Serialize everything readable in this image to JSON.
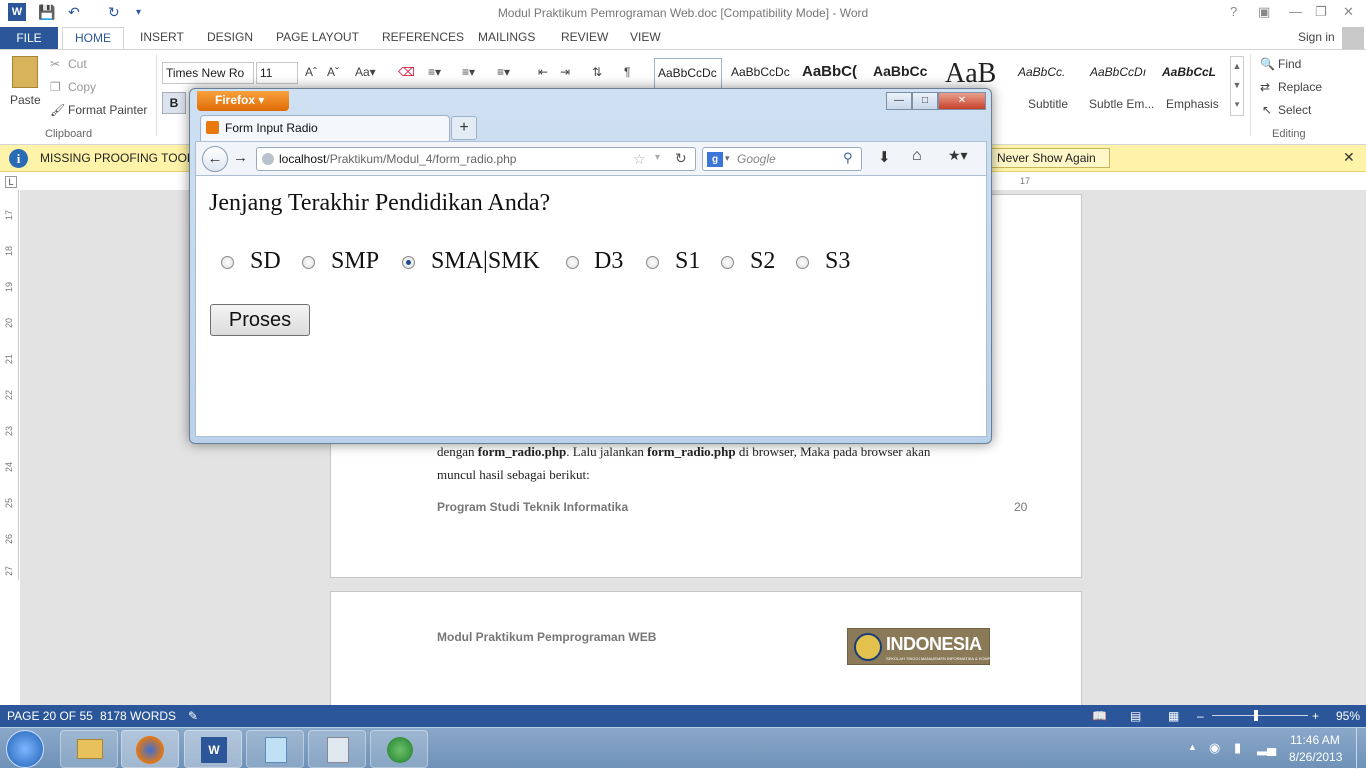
{
  "word": {
    "window_title": "Modul Praktikum Pemrograman Web.doc [Compatibility Mode] - Word",
    "tabs": [
      "FILE",
      "HOME",
      "INSERT",
      "DESIGN",
      "PAGE LAYOUT",
      "REFERENCES",
      "MAILINGS",
      "REVIEW",
      "VIEW"
    ],
    "sign_in": "Sign in",
    "help": "?",
    "clipboard": {
      "paste": "Paste",
      "cut": "Cut",
      "copy": "Copy",
      "format_painter": "Format Painter",
      "label": "Clipboard"
    },
    "font": {
      "name": "Times New Ro",
      "size": "11",
      "bold": "B"
    },
    "styles": [
      {
        "sample": "AaBbCcDc",
        "name": ""
      },
      {
        "sample": "AaBbCcDc",
        "name": ""
      },
      {
        "sample": "AaBbC(",
        "name": ""
      },
      {
        "sample": "AaBbCc",
        "name": ""
      },
      {
        "sample": "AaB",
        "name": ""
      },
      {
        "sample": "AaBbCc.",
        "name": "Subtitle"
      },
      {
        "sample": "AaBbCcDı",
        "name": "Subtle Em..."
      },
      {
        "sample": "AaBbCcL",
        "name": "Emphasis"
      }
    ],
    "editing": {
      "find": "Find",
      "replace": "Replace",
      "select": "Select",
      "label": "Editing"
    },
    "infobar": {
      "text": "MISSING PROOFING TOOLS",
      "button": "Never Show Again"
    },
    "ruler_top_marker": "17",
    "vruler_numbers": [
      "17",
      "18",
      "19",
      "20",
      "21",
      "22",
      "23",
      "24",
      "25",
      "26",
      "27"
    ],
    "page1": {
      "body_line1_a": "dengan ",
      "body_line1_b": "form_radio.php",
      "body_line1_c": ". Lalu jalankan ",
      "body_line1_d": "form_radio.php",
      "body_line1_e": " di browser, Maka pada browser akan",
      "body_line2": "muncul hasil sebagai berikut:",
      "footer_left": "Program Studi Teknik Informatika",
      "footer_right": "20"
    },
    "page2": {
      "header_left": "Modul Praktikum Pemprograman WEB",
      "logo_text": "INDONESIA",
      "logo_subtext": "SEKOLAH TINGGI MANAJEMEN INFORMATIKA & KOMPUTER"
    },
    "status": {
      "page": "PAGE 20 OF 55",
      "words": "8178 WORDS",
      "zoom": "95%"
    }
  },
  "firefox": {
    "menu_button": "Firefox",
    "tab_title": "Form Input Radio",
    "url_host": "localhost",
    "url_path": "/Praktikum/Modul_4/form_radio.php",
    "search_placeholder": "Google",
    "heading": "Jenjang Terakhir Pendidikan Anda?",
    "options": [
      "SD",
      "SMP",
      "SMA|SMK",
      "D3",
      "S1",
      "S2",
      "S3"
    ],
    "selected": "SMA|SMK",
    "submit": "Proses"
  },
  "taskbar": {
    "time": "11:46 AM",
    "date": "8/26/2013"
  },
  "colors": {
    "word_blue": "#2b579a",
    "infobar": "#fff3a9",
    "firefox_orange": "#e8790f"
  }
}
